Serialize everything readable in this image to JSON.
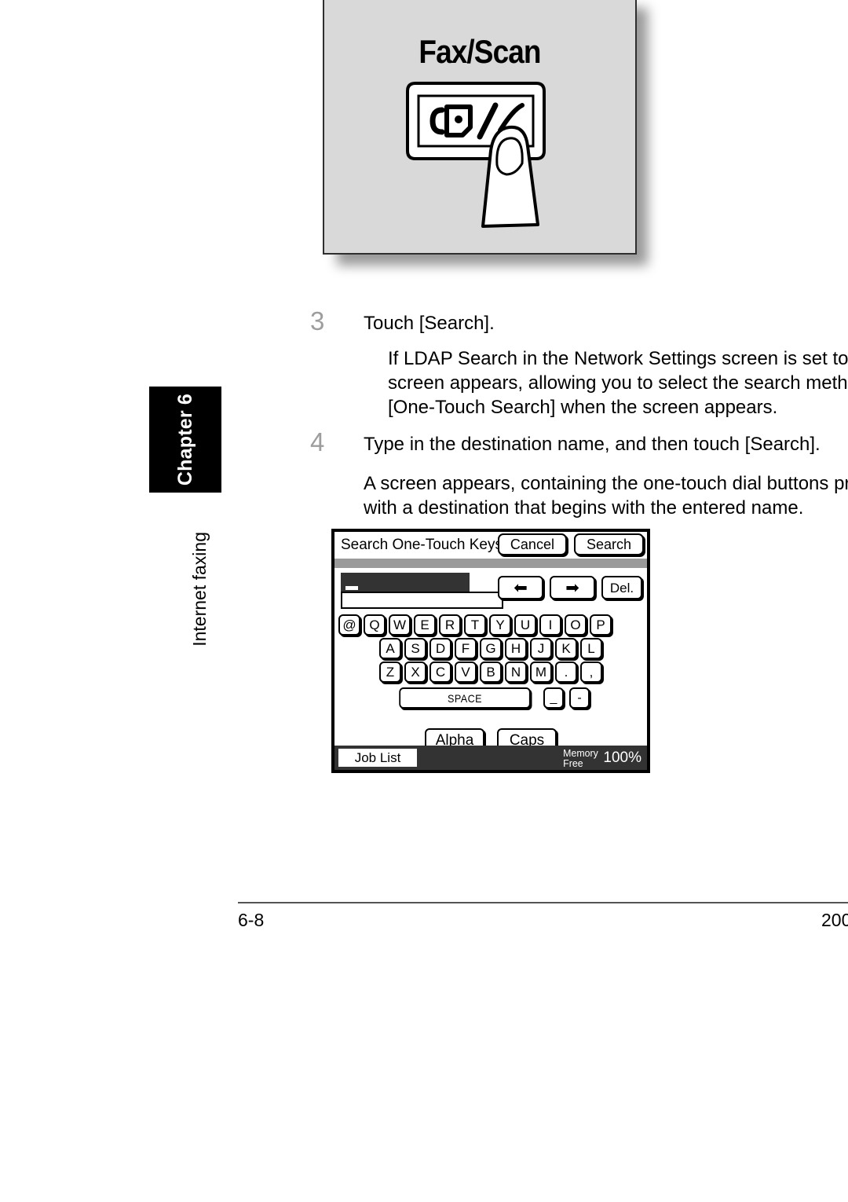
{
  "page": {
    "chapter_tab": "Chapter 6",
    "section_tab": "Internet faxing",
    "footer_page_number": "6-8",
    "footer_right": "200"
  },
  "figure_faxscan": {
    "key_label": "Fax/Scan",
    "icon": "fax-scan-key-with-finger"
  },
  "steps": [
    {
      "number": "3",
      "title": "Touch [Search].",
      "body_lines": [
        "If  LDAP Search  in the Network Settings screen is set to",
        "screen appears, allowing you to select the search method",
        "[One-Touch Search] when the screen appears."
      ]
    },
    {
      "number": "4",
      "title": "Type in the destination name, and then touch [Search].",
      "body_lines": [
        "A screen appears, containing the one-touch dial buttons progr",
        "with a destination that begins with the entered name."
      ]
    }
  ],
  "lcd": {
    "title": "Search One-Touch Keys",
    "cancel_label": "Cancel",
    "search_label": "Search",
    "input_value": "",
    "cursor": "_",
    "nav": {
      "left_arrow": "⬅",
      "right_arrow": "➡",
      "delete_label": "Del."
    },
    "keyboard": {
      "row1": [
        "@",
        "Q",
        "W",
        "E",
        "R",
        "T",
        "Y",
        "U",
        "I",
        "O",
        "P"
      ],
      "row2": [
        "A",
        "S",
        "D",
        "F",
        "G",
        "H",
        "J",
        "K",
        "L"
      ],
      "row3": [
        "Z",
        "X",
        "C",
        "V",
        "B",
        "N",
        "M",
        ".",
        ","
      ],
      "space_label": "SPACE",
      "underscore": "_",
      "hyphen": "-"
    },
    "mode_buttons": [
      "Alpha",
      "Caps"
    ],
    "status": {
      "job_list_label": "Job List",
      "memory_label_line1": "Memory",
      "memory_label_line2": "Free",
      "memory_percent": "100%"
    }
  },
  "colors": {
    "figure_fill": "#d9d9d9",
    "step_number": "#9d9d9d",
    "lcd_status_bar": "#333333",
    "lcd_separator": "#9a9a9a"
  }
}
